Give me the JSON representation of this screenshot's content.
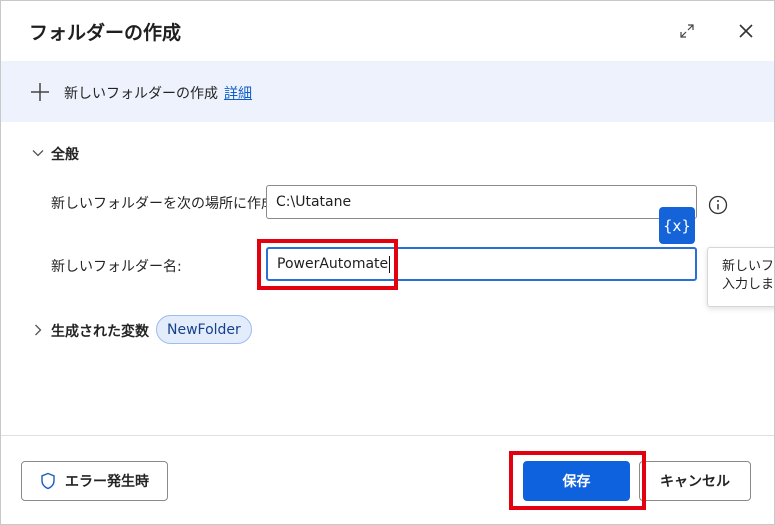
{
  "dialog": {
    "title": "フォルダーの作成"
  },
  "banner": {
    "text": "新しいフォルダーの作成",
    "link": "詳細"
  },
  "general": {
    "section_title": "全般",
    "location_label": "新しいフォルダーを次の場所に作成:",
    "location_value": "C:\\Utatane",
    "name_label": "新しいフォルダー名:",
    "name_value": "PowerAutomate",
    "variable_button": "{x}",
    "tooltip_line1": "新しいフォル",
    "tooltip_line2": "入力しま"
  },
  "generated": {
    "section_title": "生成された変数",
    "variable": "NewFolder"
  },
  "footer": {
    "on_error": "エラー発生時",
    "save": "保存",
    "cancel": "キャンセル"
  },
  "colors": {
    "accent": "#0f62dd",
    "banner_bg": "#edf2fc",
    "highlight": "#e3000f"
  },
  "icons": {
    "expand": "expand-icon",
    "close": "close-icon",
    "plus": "plus-icon",
    "info": "info-icon",
    "shield": "shield-icon",
    "chevron_down": "chevron-down-icon",
    "chevron_right": "chevron-right-icon"
  }
}
